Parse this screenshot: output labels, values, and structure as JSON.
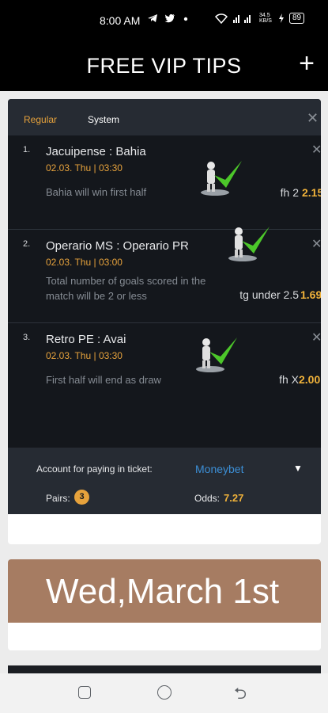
{
  "status_bar": {
    "time": "8:00 AM",
    "notification_icons": [
      "telegram-icon",
      "twitter-icon",
      "dot-icon"
    ],
    "network_speed": "34.5 KB/S",
    "battery": "89"
  },
  "app_bar": {
    "title": "FREE VIP TIPS",
    "add_label": "+"
  },
  "ticket": {
    "tabs": [
      {
        "label": "Regular",
        "active": true
      },
      {
        "label": "System",
        "active": false
      }
    ],
    "tips": [
      {
        "number": "1.",
        "match": "Jacuipense : Bahia",
        "datetime": "02.03. Thu | 03:30",
        "description": "Bahia  will win first half",
        "bet": "fh 2",
        "odd": "2.15",
        "status": "won"
      },
      {
        "number": "2.",
        "match": "Operario MS : Operario PR",
        "datetime": "02.03. Thu | 03:00",
        "description": "Total number of goals scored in the match will be 2 or less",
        "bet": "tg under 2.5",
        "odd": "1.69",
        "status": "won"
      },
      {
        "number": "3.",
        "match": "Retro PE : Avai",
        "datetime": "02.03. Thu | 03:30",
        "description": "First half will end as draw",
        "bet": "fh X",
        "odd": "2.00",
        "status": "won"
      }
    ],
    "footer": {
      "account_label": "Account for paying in ticket:",
      "account_value": "Moneybet",
      "pairs_label": "Pairs:",
      "pairs_count": "3",
      "odds_label": "Odds:",
      "odds_value": "7.27"
    }
  },
  "date_banner": {
    "text": "Wed,March 1st"
  },
  "colors": {
    "accent_orange": "#e6a23c",
    "odds_gold": "#f0b23a",
    "link_blue": "#3c8fd6",
    "check_green": "#4cc72a",
    "banner_brown": "#a67c62",
    "ticket_bg": "#14171c"
  }
}
